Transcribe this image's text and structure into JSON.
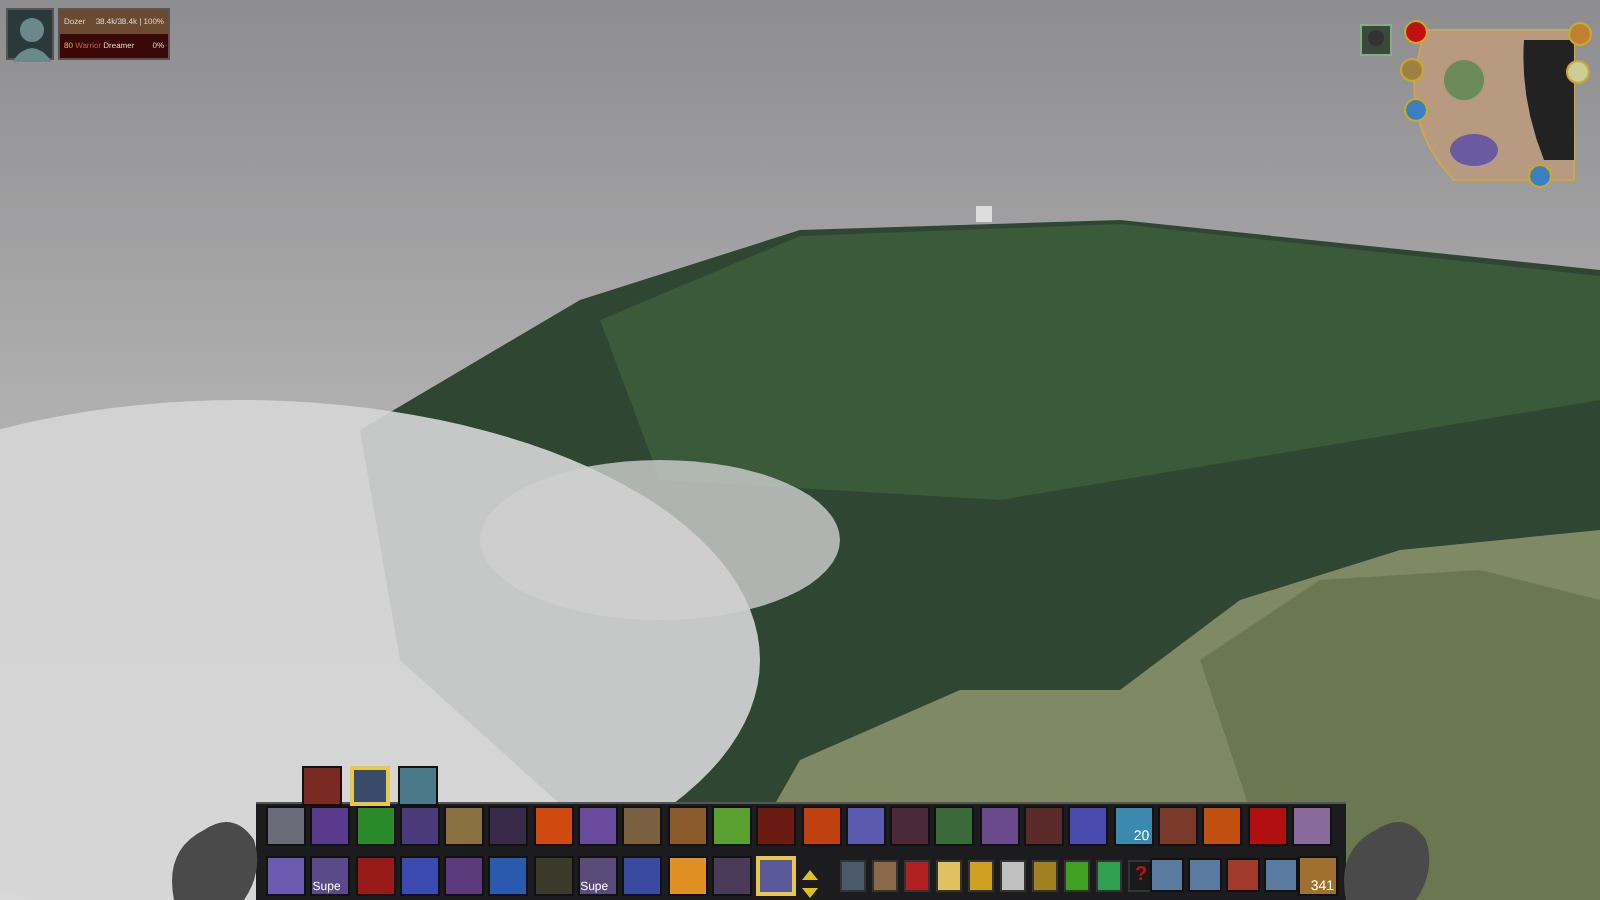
{
  "player_frame": {
    "name": "Dozer",
    "health_text": "38.4k/38.4k | 100%",
    "health": {
      "level": 1
    },
    "level_text": "80",
    "class": "Warrior",
    "title": "Dreamer",
    "power_text": "0%"
  },
  "stance_bar": [
    {
      "color": "#7a2a22",
      "selected": false
    },
    {
      "color": "#3a4a6a",
      "selected": true
    },
    {
      "color": "#4a7a8a",
      "selected": false
    }
  ],
  "action_bar_top": [
    {
      "color": "#6a6a78"
    },
    {
      "color": "#5a3a8a"
    },
    {
      "color": "#2a8a2a"
    },
    {
      "color": "#4a3a7a"
    },
    {
      "color": "#8a7040"
    },
    {
      "color": "#3a2a4a"
    },
    {
      "color": "#d04a10"
    },
    {
      "color": "#6a4a9a"
    },
    {
      "color": "#7a6040"
    },
    {
      "color": "#8a5a2a"
    },
    {
      "color": "#5aa030"
    },
    {
      "color": "#6a1a10"
    },
    {
      "color": "#c04010"
    },
    {
      "color": "#5a5ab0"
    },
    {
      "color": "#4a2a3a"
    },
    {
      "color": "#3a6a3a"
    },
    {
      "color": "#6a4a8a"
    },
    {
      "color": "#5a2a2a"
    },
    {
      "color": "#4a4ab0"
    },
    {
      "color": "#3a8ab0"
    },
    {
      "color": "#7a3a2a"
    },
    {
      "color": "#c05010"
    },
    {
      "color": "#b01010"
    },
    {
      "color": "#8a6a9a"
    }
  ],
  "action_bar_bottom": [
    {
      "color": "#6a5ab0",
      "selected": false
    },
    {
      "color": "#5a4a8a",
      "label": "Supe",
      "selected": false
    },
    {
      "color": "#9a1a1a",
      "selected": false
    },
    {
      "color": "#3a4ab0",
      "selected": false
    },
    {
      "color": "#5a3a7a",
      "selected": false
    },
    {
      "color": "#2a5ab0",
      "selected": false
    },
    {
      "color": "#3a3a2a",
      "selected": false
    },
    {
      "color": "#5a4a7a",
      "label": "Supe",
      "selected": false
    },
    {
      "color": "#3a4aa0",
      "selected": false
    },
    {
      "color": "#e09020",
      "selected": false
    },
    {
      "color": "#4a3a5a",
      "selected": false
    },
    {
      "color": "#5a5a9a",
      "selected": true
    }
  ],
  "micro_menu": [
    {
      "color": "#4a5a6a"
    },
    {
      "color": "#8a6a4a"
    },
    {
      "color": "#b02020"
    },
    {
      "color": "#e0c060"
    },
    {
      "color": "#d0a020"
    },
    {
      "color": "#c0c0c0"
    },
    {
      "color": "#a08020"
    },
    {
      "color": "#40a020"
    },
    {
      "color": "#30a050"
    },
    {
      "color": "#c01010",
      "text": "?"
    }
  ],
  "side_bar": [
    {
      "color": "#5a7aa0"
    },
    {
      "color": "#5a7aa0"
    },
    {
      "color": "#a03a2a"
    },
    {
      "color": "#5a7aa0"
    }
  ],
  "bag_slot": {
    "color": "#a07030",
    "count": "341"
  },
  "extra_count": "20"
}
